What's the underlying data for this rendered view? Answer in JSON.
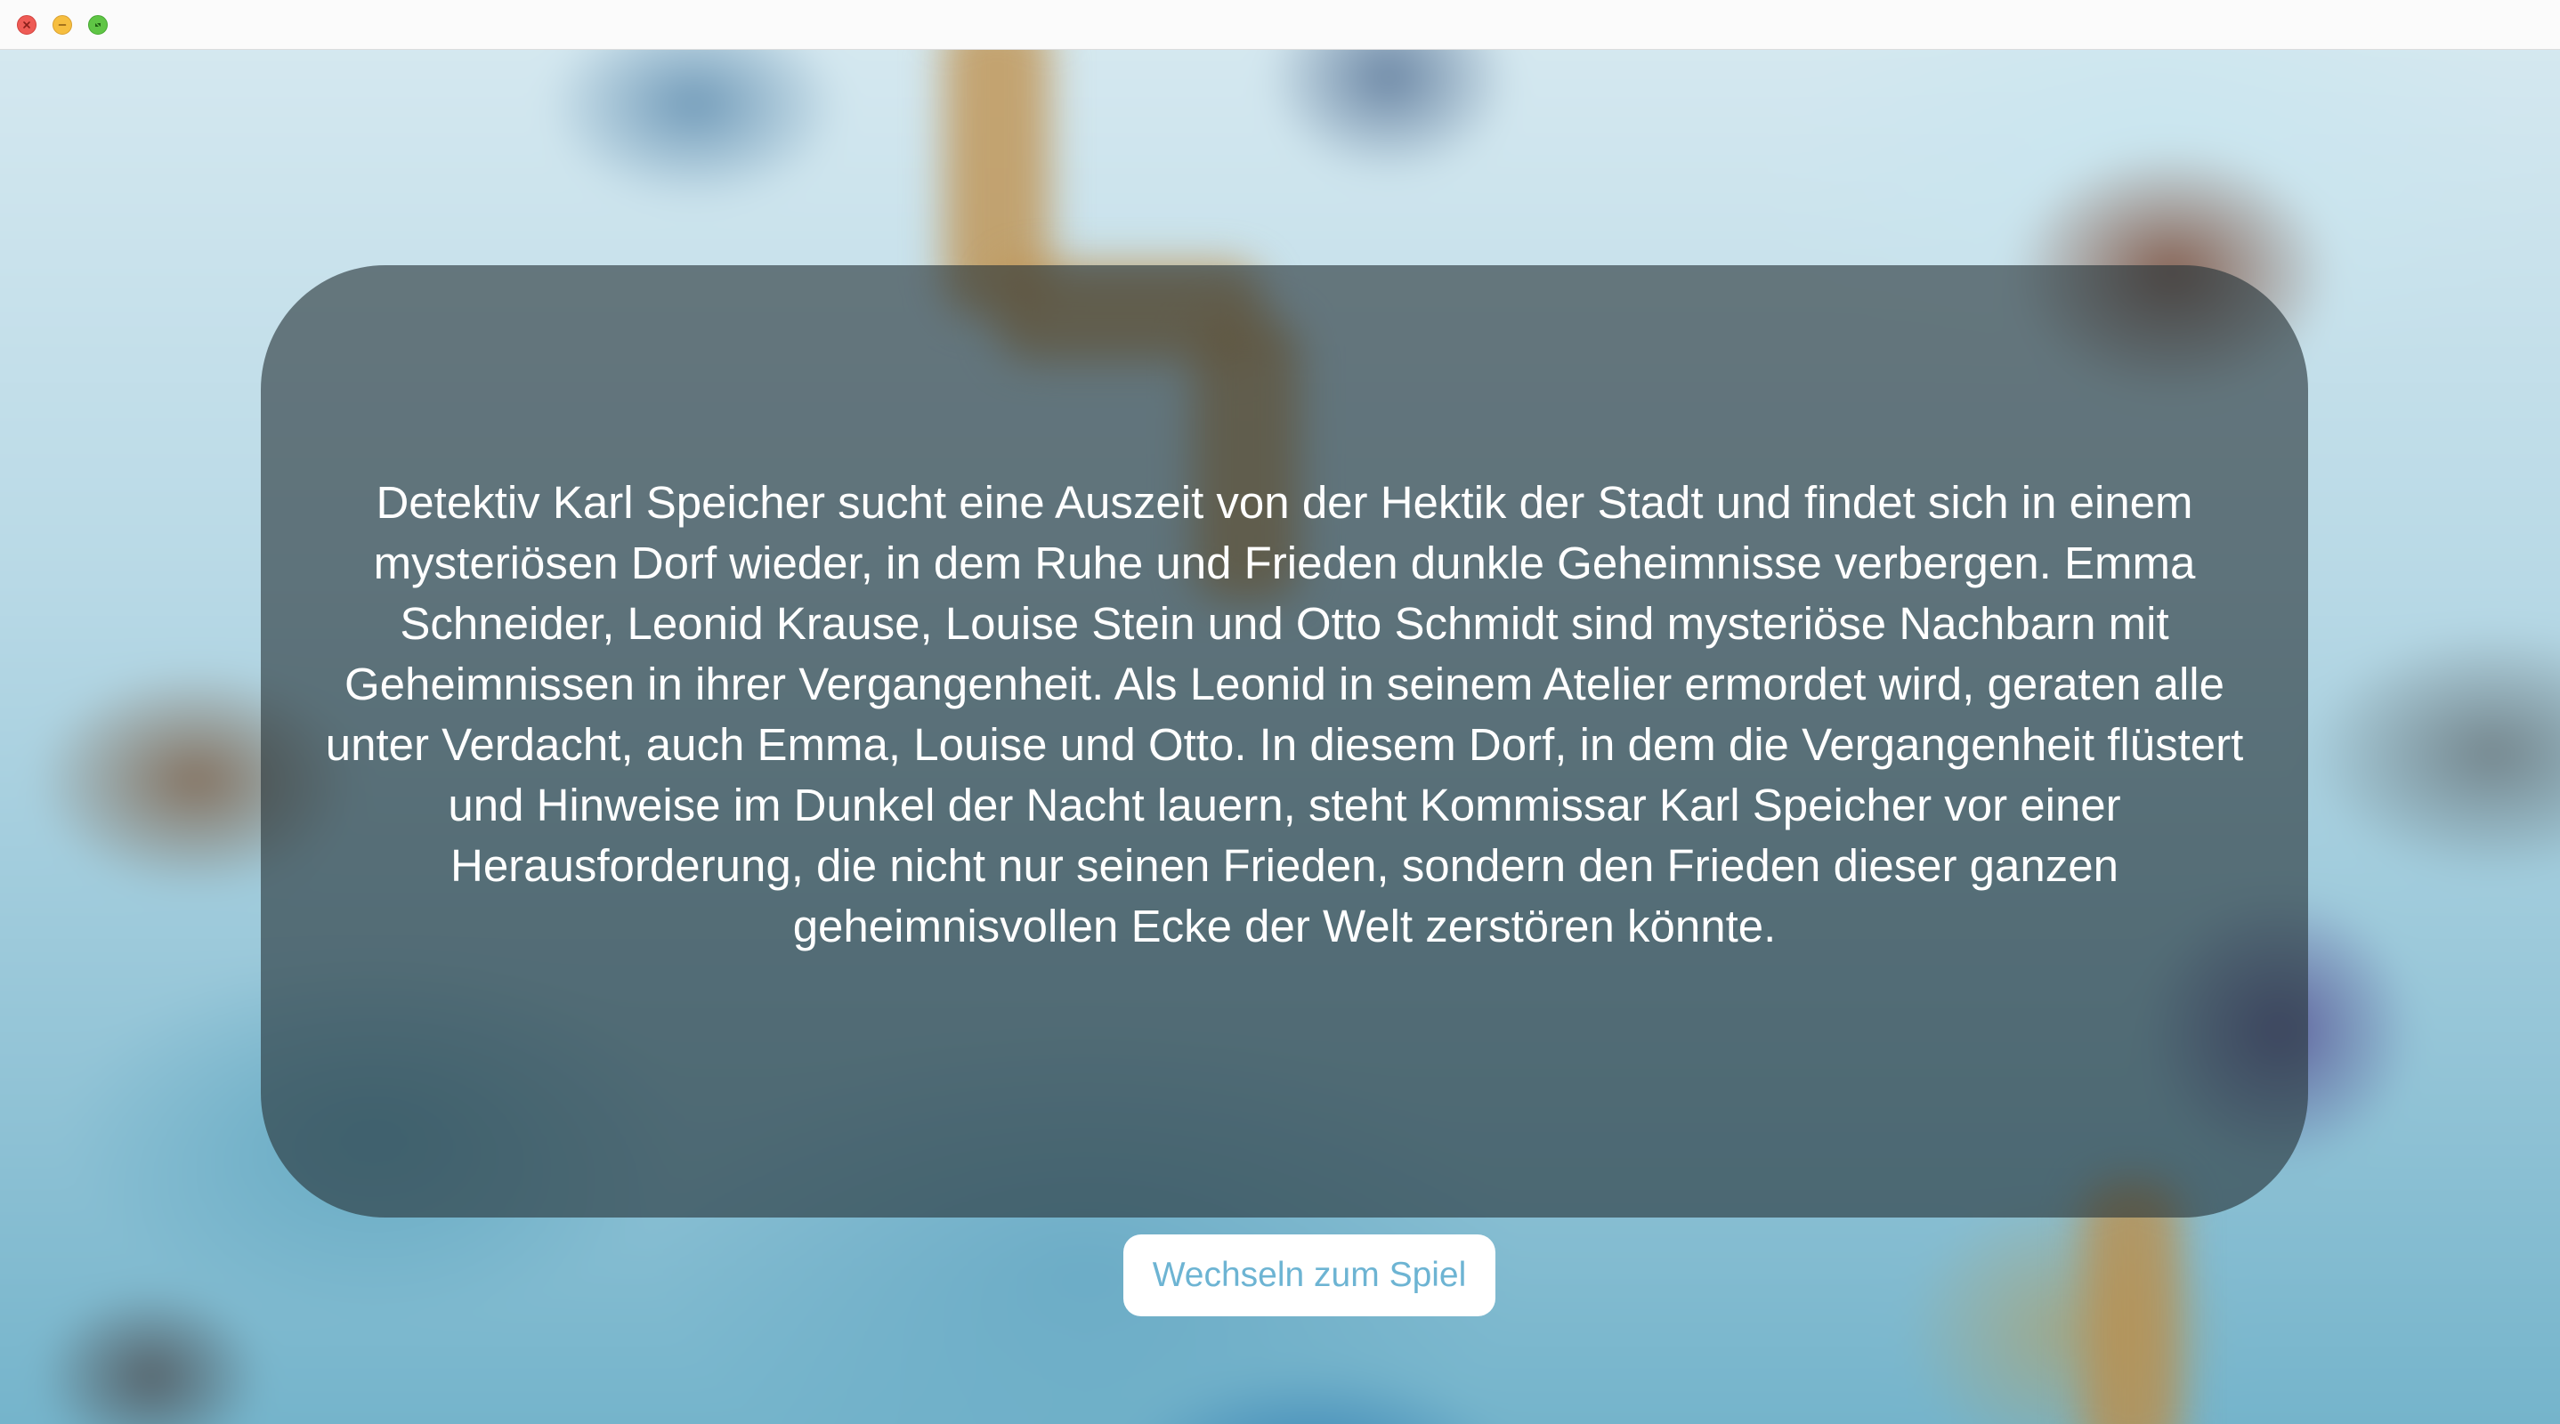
{
  "window": {
    "controls": {
      "close_icon": "close-icon",
      "minimize_icon": "minimize-icon",
      "zoom_icon": "zoom-icon"
    }
  },
  "story": {
    "text": "Detektiv Karl Speicher sucht eine Auszeit von der Hektik der Stadt und findet sich in einem mysteriösen Dorf wieder, in dem Ruhe und Frieden dunkle Geheimnisse verbergen. Emma Schneider, Leonid Krause, Louise Stein und Otto Schmidt sind mysteriöse Nachbarn mit Geheimnissen in ihrer Vergangenheit. Als Leonid in seinem Atelier ermordet wird, geraten alle unter Verdacht, auch Emma, Louise und Otto. In diesem Dorf, in dem die Vergangenheit flüstert und Hinweise im Dunkel der Nacht lauern, steht Kommissar Karl Speicher vor einer Herausforderung, die nicht nur seinen Frieden, sondern den Frieden dieser ganzen geheimnisvollen Ecke der Welt zerstören könnte."
  },
  "actions": {
    "switch_label": "Wechseln zum Spiel"
  },
  "colors": {
    "panel": "#263438",
    "button_text": "#6db4d3",
    "close": "#ee5b55",
    "minimize": "#f6be3f",
    "zoom": "#5fc545"
  }
}
